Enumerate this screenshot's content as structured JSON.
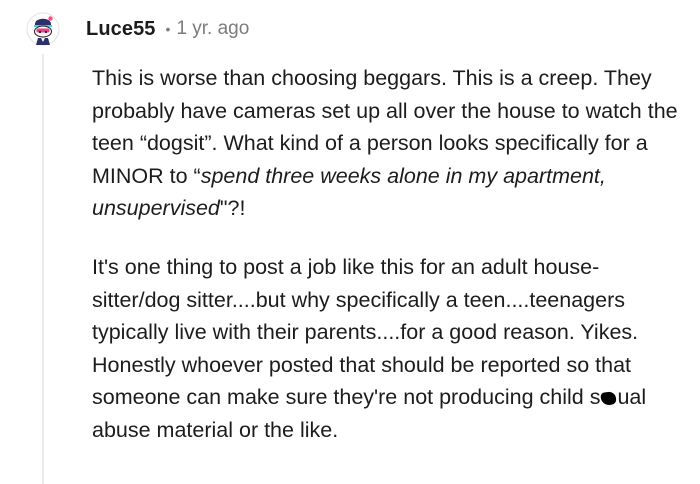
{
  "comment": {
    "author": "Luce55",
    "separator": "•",
    "timestamp": "1 yr. ago",
    "avatar_icon": "reddit-snoo-avatar",
    "paragraphs": [
      {
        "segments": [
          {
            "text": "This is worse than choosing beggars. This is a creep. They probably have cameras set up all over the house to watch the teen “dogsit”. What kind of a person looks specifically for a MINOR to “",
            "italic": false
          },
          {
            "text": "spend three weeks alone in my apartment, unsupervised",
            "italic": true
          },
          {
            "text": "\"?!",
            "italic": false
          }
        ]
      },
      {
        "segments": [
          {
            "text": "It's one thing to post a job like this for an adult house-sitter/dog sitter....but why specifically a teen....teenagers typically live with their parents....for a good reason. Yikes. Honestly whoever posted that should be reported so that someone can make sure they're not producing child s",
            "italic": false
          },
          {
            "text": "",
            "censor": true
          },
          {
            "text": "ual abuse material or the like.",
            "italic": false
          }
        ]
      }
    ]
  },
  "colors": {
    "text": "#1c1c1c",
    "meta": "#7c7c7c",
    "thread_line": "#e9ecef",
    "censor_mark": "#000000"
  }
}
